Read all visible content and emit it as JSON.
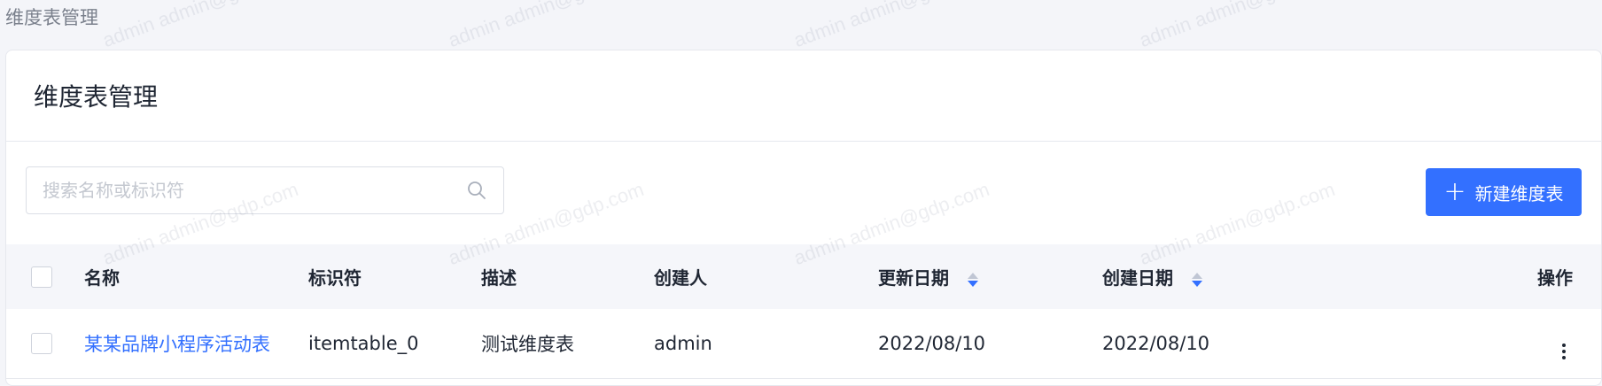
{
  "breadcrumb": "维度表管理",
  "card": {
    "title": "维度表管理"
  },
  "search": {
    "placeholder": "搜索名称或标识符",
    "icon": "search-icon"
  },
  "new_button": {
    "icon": "plus-icon",
    "label": "新建维度表"
  },
  "table": {
    "headers": [
      "名称",
      "标识符",
      "描述",
      "创建人",
      "更新日期",
      "创建日期",
      "操作"
    ],
    "rows": [
      {
        "name": "某某品牌小程序活动表",
        "identifier": "itemtable_0",
        "description": "测试维度表",
        "creator": "admin",
        "updated": "2022/08/10",
        "created": "2022/08/10",
        "action_icon": "more-vertical-icon"
      }
    ]
  },
  "watermark": {
    "text": "admin admin@gdp.com"
  },
  "colors": {
    "accent": "#3370ff",
    "page_bg": "#f4f5f9",
    "header_bg": "#f5f6fa",
    "text": "#1f2633"
  }
}
